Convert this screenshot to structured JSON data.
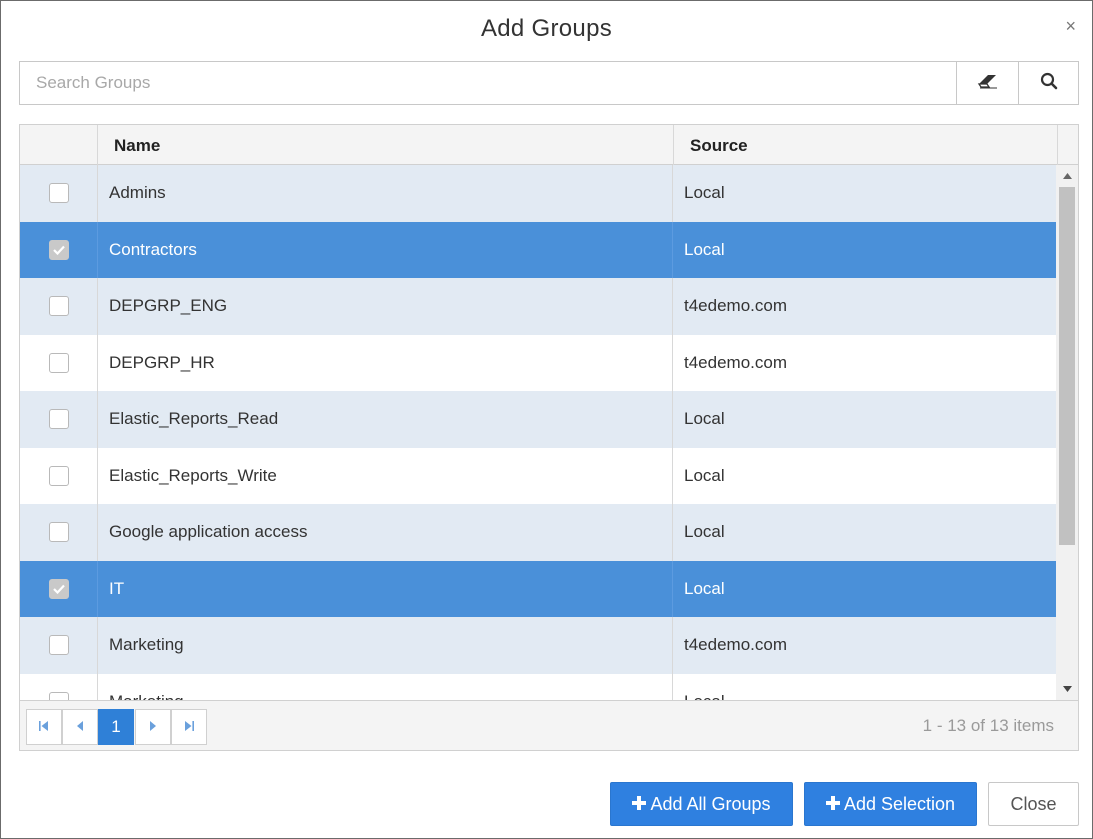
{
  "dialog": {
    "title": "Add Groups",
    "close_glyph": "×"
  },
  "search": {
    "placeholder": "Search Groups",
    "value": "",
    "clear_icon": "eraser-icon",
    "search_icon": "search-icon"
  },
  "grid": {
    "columns": {
      "name": "Name",
      "source": "Source"
    },
    "rows": [
      {
        "name": "Admins",
        "source": "Local",
        "selected": false
      },
      {
        "name": "Contractors",
        "source": "Local",
        "selected": true
      },
      {
        "name": "DEPGRP_ENG",
        "source": "t4edemo.com",
        "selected": false
      },
      {
        "name": "DEPGRP_HR",
        "source": "t4edemo.com",
        "selected": false
      },
      {
        "name": "Elastic_Reports_Read",
        "source": "Local",
        "selected": false
      },
      {
        "name": "Elastic_Reports_Write",
        "source": "Local",
        "selected": false
      },
      {
        "name": "Google application access",
        "source": "Local",
        "selected": false
      },
      {
        "name": "IT",
        "source": "Local",
        "selected": true
      },
      {
        "name": "Marketing",
        "source": "t4edemo.com",
        "selected": false
      },
      {
        "name": "Marketing",
        "source": "Local",
        "selected": false
      }
    ]
  },
  "pager": {
    "current_page": "1",
    "info": "1 - 13 of 13 items"
  },
  "footer": {
    "add_all_label": "Add All Groups",
    "add_selection_label": "Add Selection",
    "close_label": "Close"
  },
  "colors": {
    "accent": "#2f80e0",
    "selected_row": "#4a90d9",
    "alt_row": "#e2eaf3"
  }
}
